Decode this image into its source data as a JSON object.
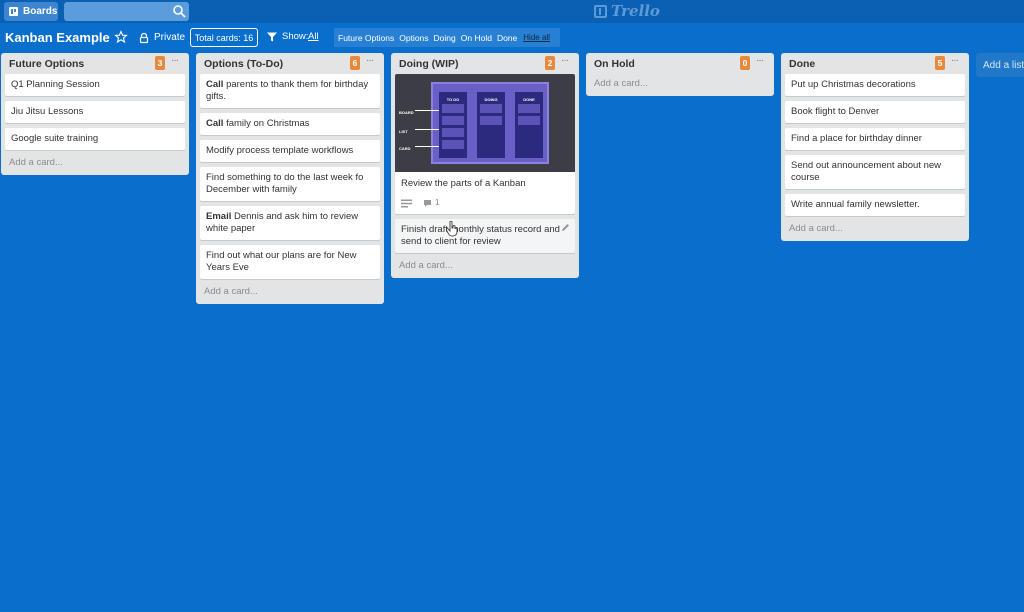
{
  "topbar": {
    "boards_label": "Boards",
    "search_value": "",
    "logo_text": "Trello"
  },
  "board": {
    "title": "Kanban Example",
    "visibility": "Private",
    "total_cards": "Total cards: 16",
    "show_label": "Show:",
    "show_all": "All",
    "filters": [
      "Future Options",
      "Options",
      "Doing",
      "On Hold",
      "Done"
    ],
    "hide_all": "Hide all"
  },
  "lists": [
    {
      "name": "Future Options",
      "count": "3",
      "cards": [
        "Q1 Planning Session",
        "Jiu Jitsu Lessons",
        "Google suite training"
      ],
      "add_card": "Add a card..."
    },
    {
      "name": "Options (To-Do)",
      "count": "6",
      "cards": [
        {
          "bold": "Call",
          "text": " parents to thank them for birthday gifts."
        },
        {
          "bold": "Call",
          "text": " family on Christmas"
        },
        {
          "bold": "",
          "text": "Modify process template workflows"
        },
        {
          "bold": "",
          "text": "Find something to do the last week fo December with family"
        },
        {
          "bold": "Email",
          "text": " Dennis and ask him to review white paper"
        },
        {
          "bold": "",
          "text": "Find out what our plans are for New Years Eve"
        }
      ],
      "add_card": "Add a card..."
    },
    {
      "name": "Doing (WIP)",
      "count": "2",
      "cover": {
        "columns": [
          "TO DO",
          "DOING",
          "DONE"
        ],
        "labels": [
          "BOARD",
          "LIST",
          "CARD"
        ]
      },
      "cards": [
        {
          "text": "Review the parts of a Kanban",
          "comments": "1"
        },
        {
          "text": "Finish draft monthly status record and send to client for review"
        }
      ],
      "add_card": "Add a card..."
    },
    {
      "name": "On Hold",
      "count": "0",
      "cards": [],
      "add_card": "Add a card..."
    },
    {
      "name": "Done",
      "count": "5",
      "cards": [
        "Put up Christmas decorations",
        "Book flight to Denver",
        "Find a place for birthday dinner",
        "Send out announcement about new course",
        "Write annual family newsletter."
      ],
      "add_card": "Add a card..."
    }
  ],
  "add_list": "Add a list...",
  "colors": {
    "background": "#0a6fcc",
    "topbar": "#0a61b3",
    "list": "#e2e4e6",
    "badge": "#e8883a"
  }
}
